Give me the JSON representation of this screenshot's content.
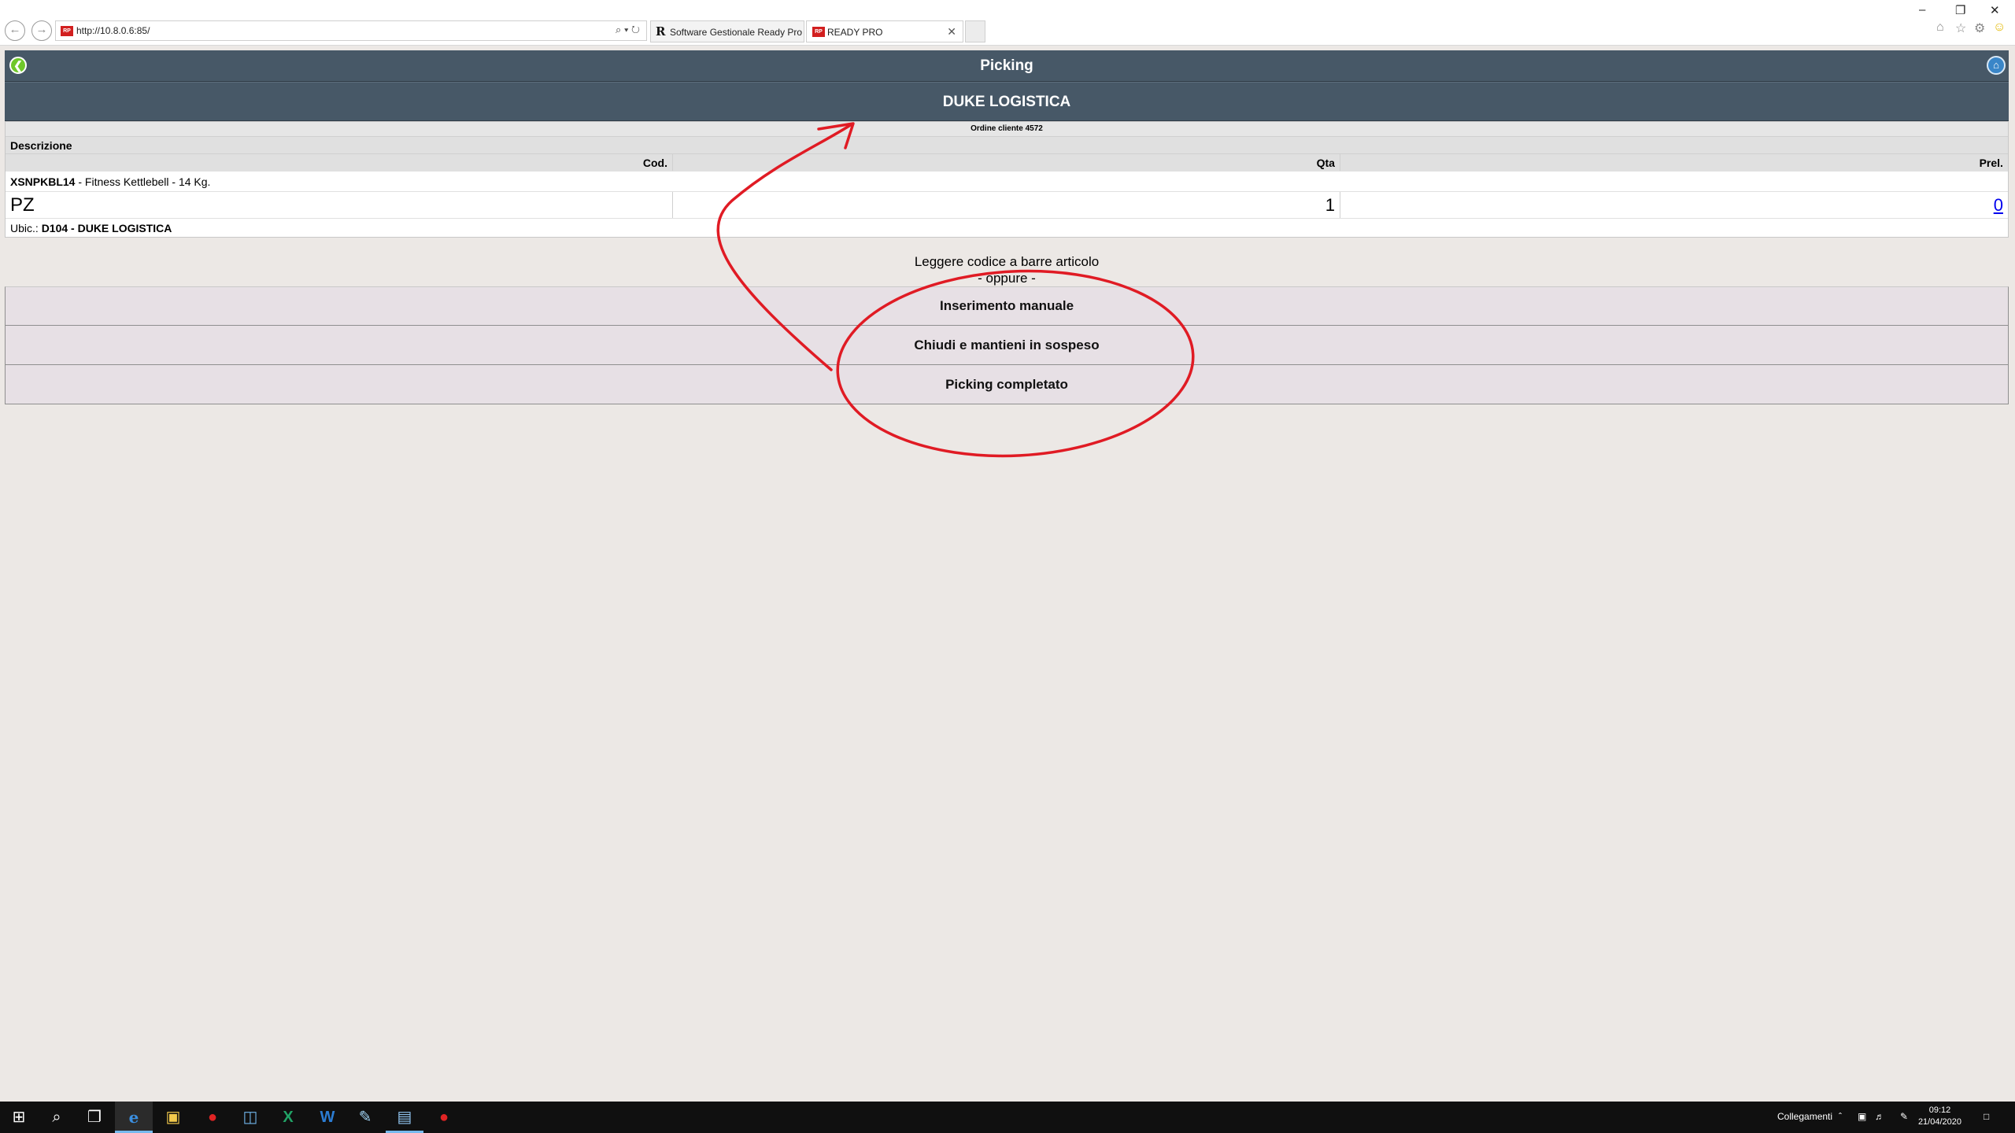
{
  "browser": {
    "address": "http://10.8.0.6:85/",
    "tabs": [
      {
        "label": "Software Gestionale Ready Pro ..."
      },
      {
        "label": "READY PRO"
      }
    ],
    "favicon_text": "RP"
  },
  "app": {
    "title": "Picking",
    "customer": "DUKE LOGISTICA",
    "order_label": "Ordine cliente 4572",
    "headers": {
      "descrizione": "Descrizione",
      "cod": "Cod.",
      "qta": "Qta",
      "prel": "Prel."
    },
    "item": {
      "code": "XSNPKBL14",
      "description": " - Fitness Kettlebell - 14 Kg.",
      "um": "PZ",
      "qta": "1",
      "prel": "0",
      "ubic_label": "Ubic.: ",
      "ubic_value": "D104 - DUKE LOGISTICA"
    },
    "scan_prompt": "Leggere codice a barre articolo",
    "or_text": "- oppure -",
    "buttons": {
      "manual": "Inserimento manuale",
      "suspend": "Chiudi e mantieni in sospeso",
      "complete": "Picking completato"
    }
  },
  "colors": {
    "header_bar": "#475867",
    "button_bg": "#e7e0e5",
    "annotation": "#e01b24",
    "page_bg": "#ece8e5"
  },
  "taskbar": {
    "links_label": "Collegamenti",
    "time": "09:12",
    "date": "21/04/2020"
  }
}
